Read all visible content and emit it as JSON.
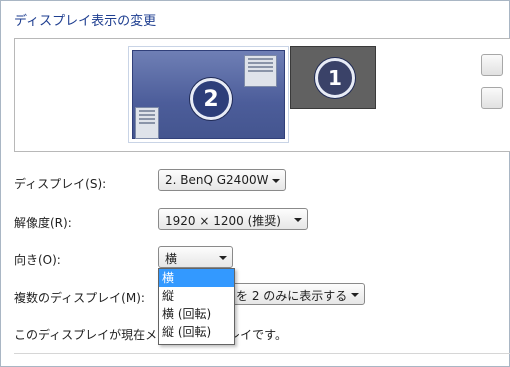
{
  "title": "ディスプレイ表示の変更",
  "monitors": [
    {
      "number": "2"
    },
    {
      "number": "1"
    }
  ],
  "fields": {
    "display_label": "ディスプレイ(S):",
    "display_value": "2. BenQ G2400W",
    "resolution_label": "解像度(R):",
    "resolution_value": "1920 × 1200 (推奨)",
    "orientation_label": "向き(O):",
    "orientation_value": "横",
    "multi_label": "複数のディスプレイ(M):",
    "multi_value_visible": "を 2 のみに表示する"
  },
  "orientation_options": [
    "横",
    "縦",
    "横 (回転)",
    "縦 (回転)"
  ],
  "status_left": "このディスプレイが現在メ",
  "status_right": "プレイです。",
  "colors": {
    "title": "#1e3e90",
    "selection": "#3399ff",
    "monitor2_screen": "#4c5d9a",
    "monitor1_screen": "#616161"
  }
}
